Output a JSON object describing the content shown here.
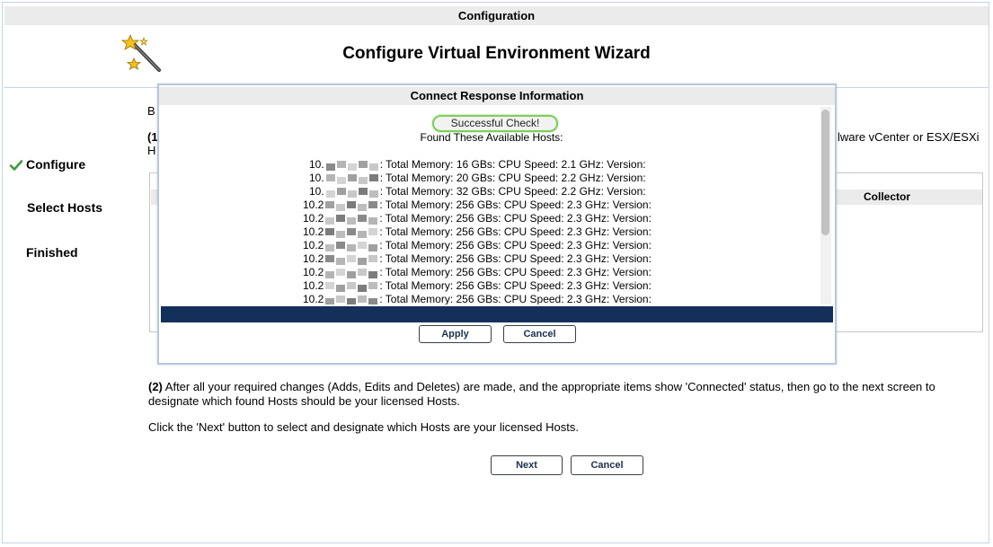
{
  "window": {
    "title": "Configuration"
  },
  "wizard": {
    "title": "Configure Virtual Environment Wizard",
    "icon": "magic-wand-icon"
  },
  "steps": [
    {
      "label": "Configure",
      "active": true
    },
    {
      "label": "Select Hosts",
      "active": false
    },
    {
      "label": "Finished",
      "active": false
    }
  ],
  "content": {
    "frag_b": "B",
    "frag_1": "(1",
    "frag_h": "H",
    "right_fragment": "lware vCenter or ESX/ESXi",
    "collector_header": "Collector",
    "step2_num": "(2)",
    "step2_text": " After all your required changes (Adds, Edits and Deletes) are made, and the appropriate items show 'Connected' status, then go to the next screen to designate which found Hosts should be your licensed Hosts.",
    "next_hint": "Click the 'Next' button to select and designate which Hosts are your licensed Hosts.",
    "next_label": "Next",
    "cancel_label": "Cancel"
  },
  "modal": {
    "title": "Connect Response Information",
    "status": "Successful Check!",
    "found_text": "Found These Available Hosts:",
    "hosts": [
      {
        "ip": "10.",
        "info": ": Total Memory: 16 GBs: CPU Speed: 2.1 GHz: Version:"
      },
      {
        "ip": "10.",
        "info": ": Total Memory: 20 GBs: CPU Speed: 2.2 GHz: Version:"
      },
      {
        "ip": "10.",
        "info": ": Total Memory: 32 GBs: CPU Speed: 2.2 GHz: Version:"
      },
      {
        "ip": "10.2",
        "info": ": Total Memory: 256 GBs: CPU Speed: 2.3 GHz: Version:"
      },
      {
        "ip": "10.2",
        "info": ": Total Memory: 256 GBs: CPU Speed: 2.3 GHz: Version:"
      },
      {
        "ip": "10.2",
        "info": ": Total Memory: 256 GBs: CPU Speed: 2.3 GHz: Version:"
      },
      {
        "ip": "10.2",
        "info": ": Total Memory: 256 GBs: CPU Speed: 2.3 GHz: Version:"
      },
      {
        "ip": "10.2",
        "info": ": Total Memory: 256 GBs: CPU Speed: 2.3 GHz: Version:"
      },
      {
        "ip": "10.2",
        "info": ": Total Memory: 256 GBs: CPU Speed: 2.3 GHz: Version:"
      },
      {
        "ip": "10.2",
        "info": ": Total Memory: 256 GBs: CPU Speed: 2.3 GHz: Version:"
      },
      {
        "ip": "10.2",
        "info": ": Total Memory: 256 GBs: CPU Speed: 2.3 GHz: Version:"
      }
    ],
    "apply_label": "Apply",
    "cancel_label": "Cancel"
  },
  "colors": {
    "navy": "#13305b",
    "success_border": "#7fce5e",
    "check_green": "#3c9a3c"
  }
}
